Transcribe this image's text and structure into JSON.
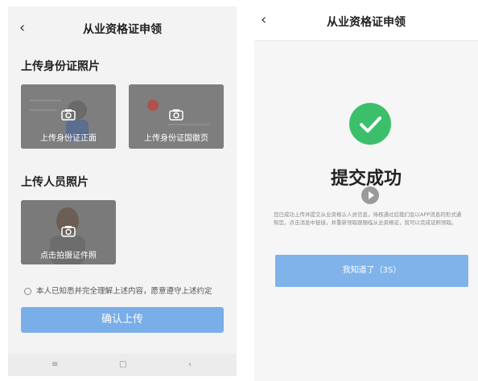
{
  "left": {
    "title": "从业资格证申领",
    "back_icon": "chevron-left-icon",
    "section_id": "上传身份证照片",
    "id_front_caption": "上传身份证正面",
    "id_back_caption": "上传身份证国徽页",
    "section_person": "上传人员照片",
    "person_caption": "点击拍摄证件照",
    "consent_text": "本人已知悉并完全理解上述内容，愿意遵守上述约定",
    "confirm_label": "确认上传",
    "sysnav": [
      "≡",
      "□",
      "‹"
    ]
  },
  "right": {
    "title": "从业资格证申领",
    "back_icon": "chevron-left-icon",
    "success_title": "提交成功",
    "description": "您已成功上传并提交从业资格认人员信息，待核通过后我们会以APP消息的形式通知您，点击消息中链接，并重新领取跟随临从业资格证，就可以完成证照领取。",
    "ok_button": "我知道了（3S）"
  },
  "colors": {
    "accent": "#79aee9",
    "success": "#3cbf6a",
    "card_overlay": "#7b7b7b"
  }
}
